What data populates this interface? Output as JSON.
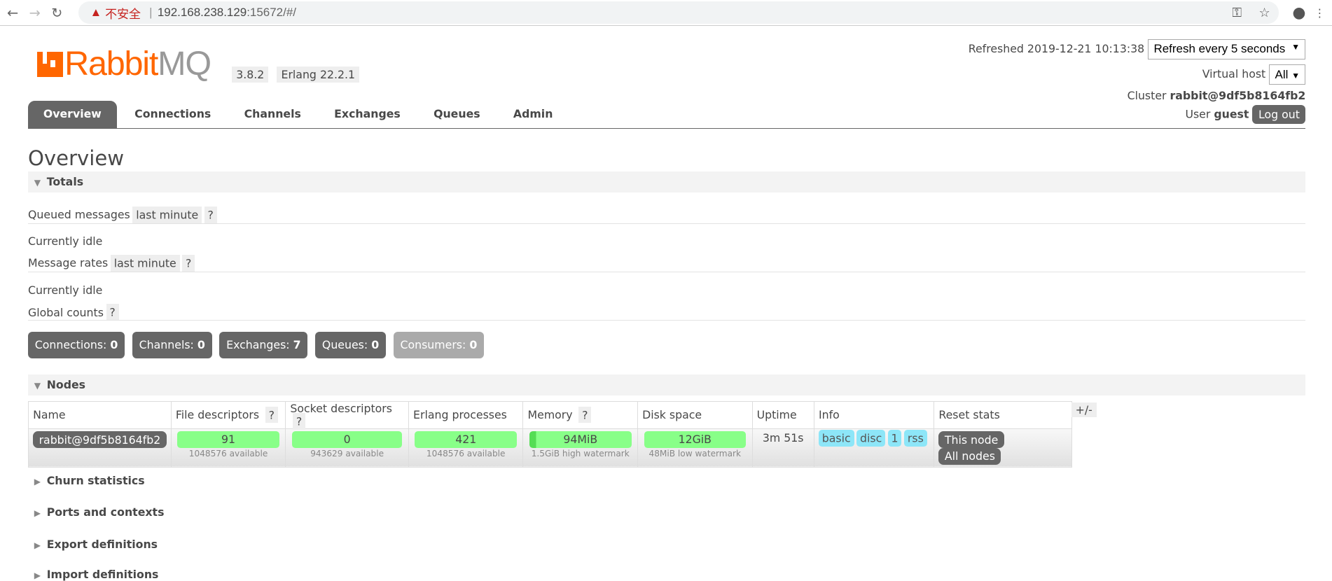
{
  "browser": {
    "security": "不安全",
    "url_host": "192.168.238.129",
    "url_rest": ":15672/#/"
  },
  "header": {
    "logo_a": "Rabbit",
    "logo_b": "MQ",
    "version": "3.8.2",
    "erlang": "Erlang 22.2.1",
    "refreshed": "Refreshed 2019-12-21 10:13:38",
    "refresh_select": "Refresh every 5 seconds",
    "vhost_label": "Virtual host",
    "vhost_value": "All",
    "cluster_label": "Cluster",
    "cluster": "rabbit@9df5b8164fb2",
    "user_label": "User",
    "user": "guest",
    "logout": "Log out"
  },
  "tabs": [
    "Overview",
    "Connections",
    "Channels",
    "Exchanges",
    "Queues",
    "Admin"
  ],
  "page_title": "Overview",
  "totals": {
    "title": "Totals",
    "queued": "Queued messages",
    "rates": "Message rates",
    "period": "last minute",
    "help": "?",
    "idle": "Currently idle",
    "global": "Global counts",
    "counts": [
      {
        "label": "Connections:",
        "value": "0"
      },
      {
        "label": "Channels:",
        "value": "0"
      },
      {
        "label": "Exchanges:",
        "value": "7"
      },
      {
        "label": "Queues:",
        "value": "0"
      },
      {
        "label": "Consumers:",
        "value": "0"
      }
    ]
  },
  "nodes": {
    "title": "Nodes",
    "headers": [
      "Name",
      "File descriptors",
      "Socket descriptors",
      "Erlang processes",
      "Memory",
      "Disk space",
      "Uptime",
      "Info",
      "Reset stats"
    ],
    "toggle": "+/-",
    "row": {
      "name": "rabbit@9df5b8164fb2",
      "fd": "91",
      "fd_sub": "1048576 available",
      "sd": "0",
      "sd_sub": "943629 available",
      "ep": "421",
      "ep_sub": "1048576 available",
      "mem": "94MiB",
      "mem_sub": "1.5GiB high watermark",
      "disk": "12GiB",
      "disk_sub": "48MiB low watermark",
      "uptime": "3m 51s",
      "info": [
        "basic",
        "disc",
        "1",
        "rss"
      ],
      "reset_this": "This node",
      "reset_all": "All nodes"
    }
  },
  "collapsed": [
    "Churn statistics",
    "Ports and contexts",
    "Export definitions",
    "Import definitions"
  ]
}
